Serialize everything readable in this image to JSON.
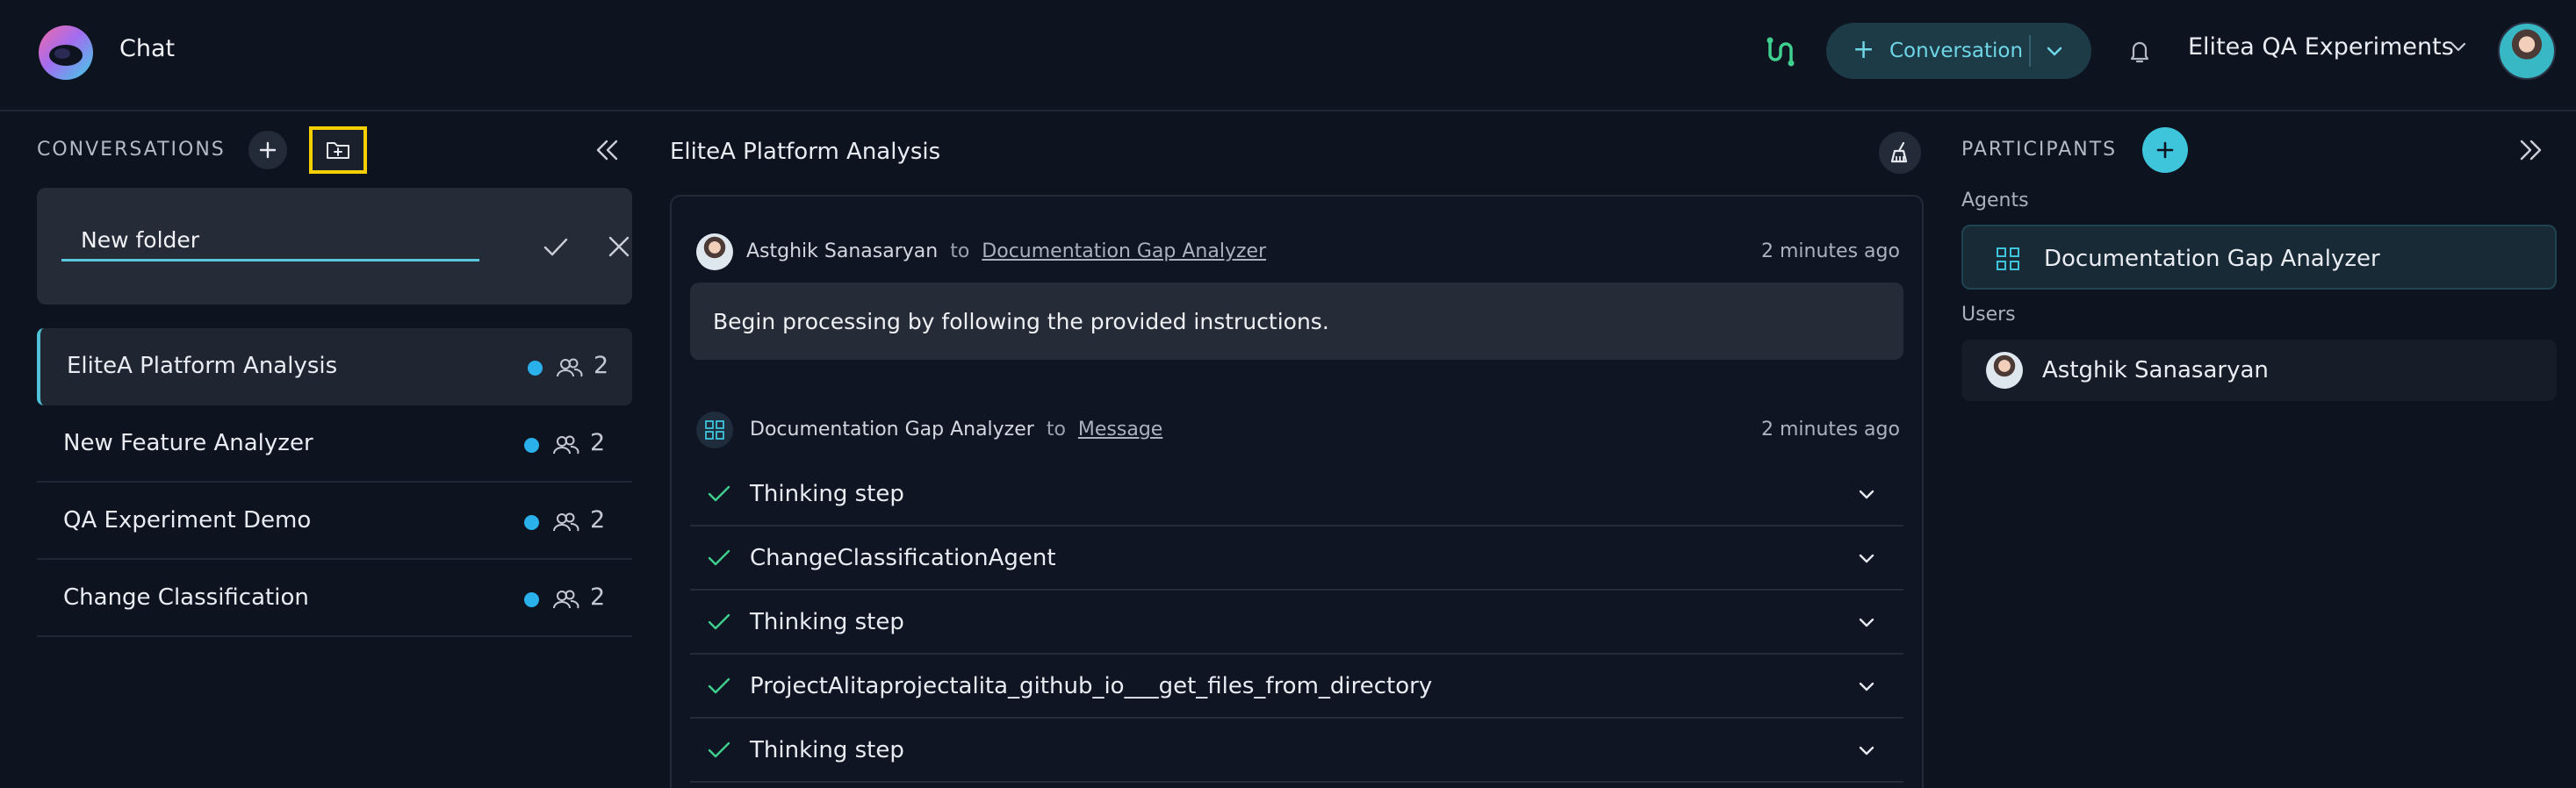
{
  "header": {
    "app_title": "Chat",
    "conversation_button": "Conversation",
    "project_name": "Elitea QA Experiments"
  },
  "left_panel": {
    "heading": "CONVERSATIONS",
    "folder_input_value": "New folder",
    "conversations": [
      {
        "name": "EliteA Platform Analysis",
        "participants": "2",
        "active": true
      },
      {
        "name": "New Feature Analyzer",
        "participants": "2",
        "active": false
      },
      {
        "name": "QA Experiment Demo",
        "participants": "2",
        "active": false
      },
      {
        "name": "Change Classification",
        "participants": "2",
        "active": false
      }
    ]
  },
  "chat": {
    "title": "EliteA Platform Analysis",
    "messages": [
      {
        "sender": "Astghik Sanasaryan",
        "to_word": "to",
        "target": "Documentation Gap Analyzer",
        "time": "2 minutes ago",
        "text": "Begin processing by following the provided instructions."
      },
      {
        "sender": "Documentation Gap Analyzer",
        "to_word": "to",
        "target": "Message",
        "time": "2 minutes ago",
        "steps": [
          "Thinking step",
          "ChangeClassificationAgent",
          "Thinking step",
          "ProjectAlitaprojectalita_github_io___get_files_from_directory",
          "Thinking step"
        ]
      }
    ]
  },
  "right_panel": {
    "heading": "PARTICIPANTS",
    "agents_label": "Agents",
    "agents": [
      "Documentation Gap Analyzer"
    ],
    "users_label": "Users",
    "users": [
      "Astghik Sanasaryan"
    ]
  },
  "colors": {
    "background": "#0e1320",
    "accent": "#3ec5dc",
    "status_dot": "#2ab0ea",
    "check_green": "#3fcf8e",
    "highlight_box": "#f5d000"
  }
}
